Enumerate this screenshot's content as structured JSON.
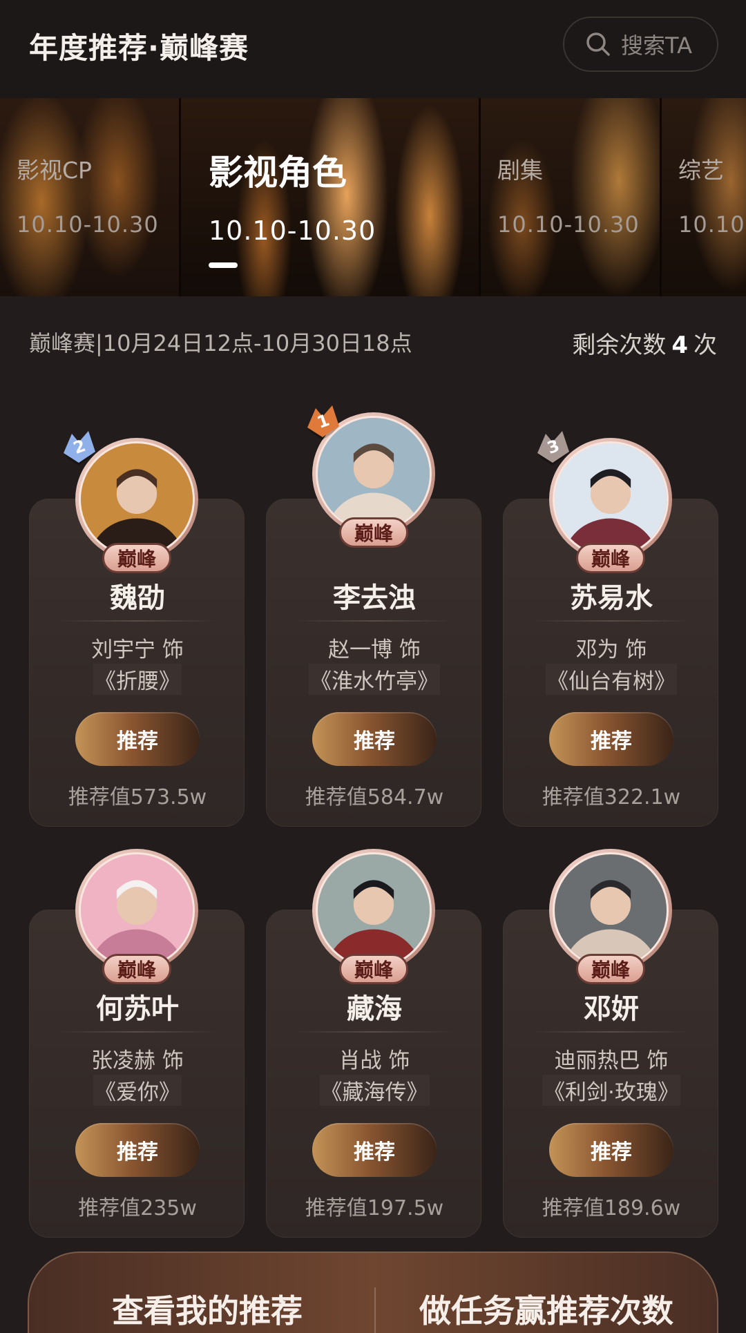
{
  "header": {
    "title": "年度推荐·巅峰赛",
    "search_placeholder": "搜索TA"
  },
  "tabs": [
    {
      "name": "影视CP",
      "dates": "10.10-10.30",
      "active": false
    },
    {
      "name": "影视角色",
      "dates": "10.10-10.30",
      "active": true
    },
    {
      "name": "剧集",
      "dates": "10.10-10.30",
      "active": false
    },
    {
      "name": "综艺",
      "dates": "10.10-",
      "active": false
    }
  ],
  "info": {
    "round": "巅峰赛|10月24日12点-10月30日18点",
    "remaining_prefix": "剩余次数",
    "remaining_count": "4",
    "remaining_suffix": "次"
  },
  "cards": [
    {
      "rank": "2",
      "badge": "巅峰",
      "character": "魏劭",
      "actor": "刘宇宁 饰",
      "drama": "《折腰》",
      "button": "推荐",
      "score": "推荐值573.5w"
    },
    {
      "rank": "1",
      "badge": "巅峰",
      "character": "李去浊",
      "actor": "赵一博 饰",
      "drama": "《淮水竹亭》",
      "button": "推荐",
      "score": "推荐值584.7w"
    },
    {
      "rank": "3",
      "badge": "巅峰",
      "character": "苏易水",
      "actor": "邓为 饰",
      "drama": "《仙台有树》",
      "button": "推荐",
      "score": "推荐值322.1w"
    },
    {
      "rank": "",
      "badge": "巅峰",
      "character": "何苏叶",
      "actor": "张凌赫 饰",
      "drama": "《爱你》",
      "button": "推荐",
      "score": "推荐值235w"
    },
    {
      "rank": "",
      "badge": "巅峰",
      "character": "藏海",
      "actor": "肖战 饰",
      "drama": "《藏海传》",
      "button": "推荐",
      "score": "推荐值197.5w"
    },
    {
      "rank": "",
      "badge": "巅峰",
      "character": "邓妍",
      "actor": "迪丽热巴 饰",
      "drama": "《利剑·玫瑰》",
      "button": "推荐",
      "score": "推荐值189.6w"
    }
  ],
  "bottom": {
    "left_label": "查看我的推荐",
    "right_label": "做任务赢推荐次数"
  },
  "colors": {
    "background": "#221d1c",
    "accent_gold": "#c39357",
    "badge_pink": "#e8b8ab"
  }
}
